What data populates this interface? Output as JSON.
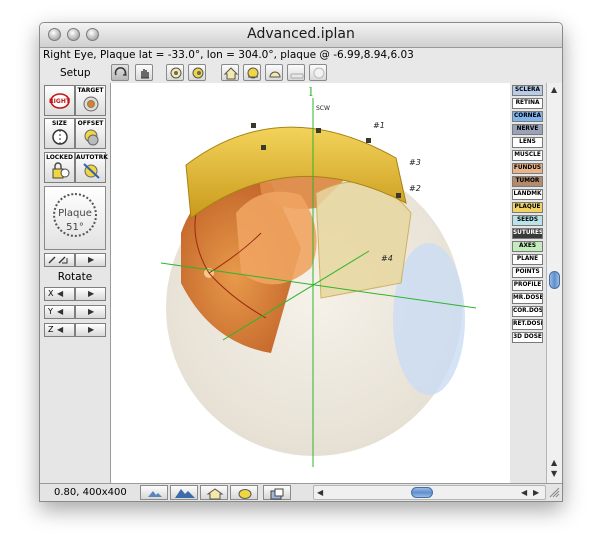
{
  "window": {
    "title": "Advanced.iplan",
    "info": "Right Eye, Plaque lat = -33.0°, lon = 304.0°, plaque @ -6.99,8.94,6.03"
  },
  "toolbar": {
    "setup_label": "Setup",
    "icons": [
      "rotate-view-icon",
      "grab-icon",
      "eye-view-left-icon",
      "eye-view-right-icon",
      "house-view-icon",
      "side-view-icon",
      "top-view-icon",
      "plate-icon",
      "empty-plate-icon"
    ]
  },
  "left_panel": {
    "buttons": [
      {
        "label": "RIGHT",
        "icon": "right-eye-icon"
      },
      {
        "label": "TARGET",
        "icon": "target-icon"
      },
      {
        "label": "SIZE",
        "icon": "size-icon"
      },
      {
        "label": "OFFSET",
        "icon": "offset-icon"
      },
      {
        "label": "LOCKED",
        "icon": "lock-icon"
      },
      {
        "label": "AUTOTRK",
        "icon": "autotrack-icon"
      }
    ],
    "dial": {
      "name": "Plaque",
      "value": "51°"
    },
    "rotate_label": "Rotate",
    "axes": [
      "X",
      "Y",
      "Z"
    ]
  },
  "right_panel": {
    "tags": [
      {
        "label": "SCLERA",
        "color": "#b7cce8"
      },
      {
        "label": "RETINA",
        "color": "#ffffff"
      },
      {
        "label": "CORNEA",
        "color": "#7fb5ec"
      },
      {
        "label": "NERVE",
        "color": "#9aa2b8"
      },
      {
        "label": "LENS",
        "color": "#ffffff"
      },
      {
        "label": "MUSCLE",
        "color": "#ffffff"
      },
      {
        "label": "FUNDUS",
        "color": "#e8b48a"
      },
      {
        "label": "TUMOR",
        "color": "#b28a6c"
      },
      {
        "label": "LANDMK",
        "color": "#ffffff"
      },
      {
        "label": "PLAQUE",
        "color": "#f1d262"
      },
      {
        "label": "SEEDS",
        "color": "#b9e4ea"
      },
      {
        "label": "SUTURES",
        "color": "#3a3a3a"
      },
      {
        "label": "AXES",
        "color": "#c2ecbc"
      },
      {
        "label": "PLANE",
        "color": "#ffffff"
      },
      {
        "label": "POINTS",
        "color": "#ffffff"
      },
      {
        "label": "PROFILE",
        "color": "#ffffff"
      },
      {
        "label": "MR.DOSE",
        "color": "#ffffff"
      },
      {
        "label": "COR.DOSE",
        "color": "#ffffff"
      },
      {
        "label": "RET.DOSE",
        "color": "#ffffff"
      },
      {
        "label": "3D DOSE",
        "color": "#ffffff"
      }
    ]
  },
  "canvas": {
    "axis_label": "l",
    "suture_labels": [
      "#1",
      "#2",
      "#3",
      "#4"
    ],
    "plaque_text": "SCW"
  },
  "statusbar": {
    "zoom_text": "0.80, 400x400",
    "buttons": [
      "mountain-small-icon",
      "mountain-large-icon",
      "home-icon",
      "eye-icon",
      "camera-icon"
    ]
  }
}
